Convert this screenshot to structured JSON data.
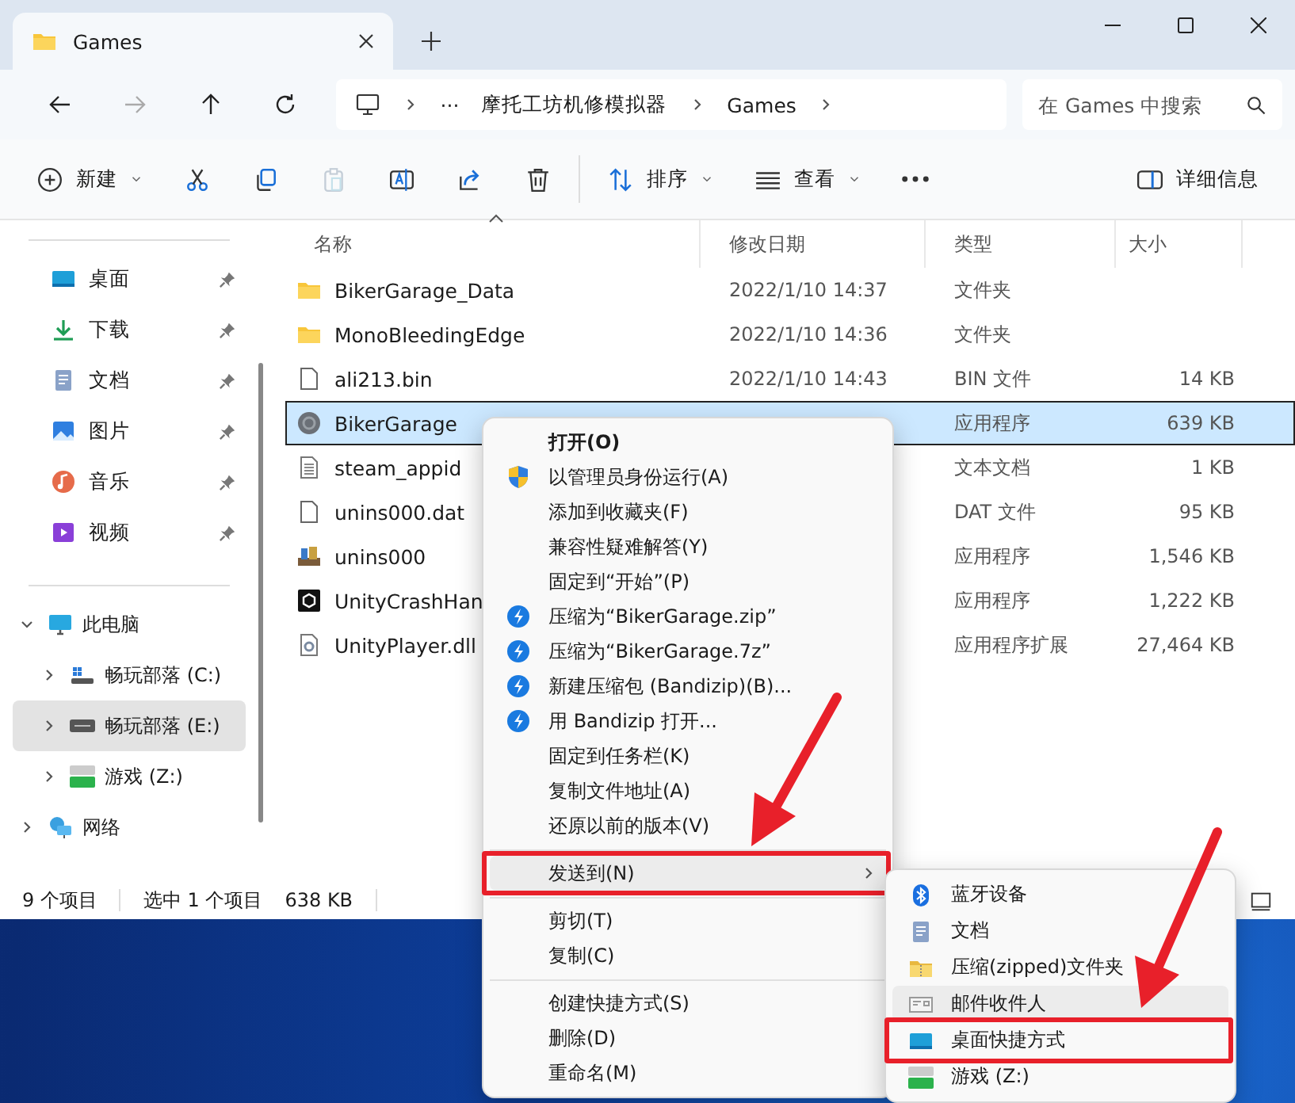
{
  "tab": {
    "title": "Games"
  },
  "address": {
    "crumbs": [
      "···",
      "摩托工坊机修模拟器",
      "Games"
    ]
  },
  "search": {
    "placeholder": "在 Games 中搜索"
  },
  "toolbar": [
    {
      "kind": "new",
      "label": "新建",
      "disabled": false
    },
    {
      "kind": "cut",
      "disabled": false
    },
    {
      "kind": "copy",
      "disabled": false
    },
    {
      "kind": "paste",
      "disabled": true
    },
    {
      "kind": "rename",
      "disabled": false
    },
    {
      "kind": "share",
      "disabled": false
    },
    {
      "kind": "delete",
      "disabled": false
    },
    {
      "kind": "separator"
    },
    {
      "kind": "sort",
      "label": "排序",
      "disabled": false
    },
    {
      "kind": "view",
      "label": "查看",
      "disabled": false
    },
    {
      "kind": "more",
      "disabled": false
    },
    {
      "kind": "spacer"
    },
    {
      "kind": "details",
      "label": "详细信息",
      "disabled": false
    }
  ],
  "sidebar": {
    "quick_access": [
      {
        "label": "桌面",
        "kind": "desktop",
        "pinned": true
      },
      {
        "label": "下载",
        "kind": "download",
        "pinned": true
      },
      {
        "label": "文档",
        "kind": "documents",
        "pinned": true
      },
      {
        "label": "图片",
        "kind": "pictures",
        "pinned": true
      },
      {
        "label": "音乐",
        "kind": "music",
        "pinned": true
      },
      {
        "label": "视频",
        "kind": "videos",
        "pinned": true
      }
    ],
    "tree": [
      {
        "label": "此电脑",
        "kind": "pc",
        "expanded": true,
        "selected": false,
        "children": [
          {
            "label": "畅玩部落 (C:)",
            "kind": "system-drive",
            "expanded": false,
            "selected": false
          },
          {
            "label": "畅玩部落 (E:)",
            "kind": "drive",
            "expanded": false,
            "selected": true
          },
          {
            "label": "游戏 (Z:)",
            "kind": "network-drive",
            "expanded": false,
            "selected": false
          }
        ]
      },
      {
        "label": "网络",
        "kind": "network",
        "expanded": false,
        "selected": false
      }
    ]
  },
  "file_list": {
    "columns": [
      {
        "label": "名称",
        "sorted": true
      },
      {
        "label": "修改日期",
        "sorted": false
      },
      {
        "label": "类型",
        "sorted": false
      },
      {
        "label": "大小",
        "sorted": false
      }
    ],
    "rows": [
      {
        "name": "BikerGarage_Data",
        "kind": "folder",
        "date": "2022/1/10 14:37",
        "type": "文件夹",
        "selected": false
      },
      {
        "name": "MonoBleedingEdge",
        "kind": "folder",
        "date": "2022/1/10 14:36",
        "type": "文件夹",
        "selected": false
      },
      {
        "name": "ali213.bin",
        "kind": "file",
        "date": "2022/1/10 14:43",
        "type": "BIN 文件",
        "size": "14 KB",
        "selected": false
      },
      {
        "name": "BikerGarage",
        "kind": "app",
        "type": "应用程序",
        "size": "639 KB",
        "selected": true
      },
      {
        "name": "steam_appid",
        "kind": "text",
        "type": "文本文档",
        "size": "1 KB",
        "selected": false
      },
      {
        "name": "unins000.dat",
        "kind": "file",
        "type": "DAT 文件",
        "size": "95 KB",
        "selected": false
      },
      {
        "name": "unins000",
        "kind": "installer",
        "type": "应用程序",
        "size": "1,546 KB",
        "selected": false
      },
      {
        "name": "UnityCrashHan",
        "kind": "engine",
        "type": "应用程序",
        "size": "1,222 KB",
        "selected": false
      },
      {
        "name": "UnityPlayer.dll",
        "kind": "dll",
        "type": "应用程序扩展",
        "size": "27,464 KB",
        "selected": false
      }
    ]
  },
  "status_bar": {
    "item_count": "9 个项目",
    "selection": "选中 1 个项目",
    "size": "638 KB"
  },
  "context_menu": [
    {
      "kind": "item",
      "label": "打开(O)",
      "default": true,
      "selected": false
    },
    {
      "kind": "admin",
      "label": "以管理员身份运行(A)",
      "selected": false
    },
    {
      "kind": "item",
      "label": "添加到收藏夹(F)",
      "selected": false
    },
    {
      "kind": "item",
      "label": "兼容性疑难解答(Y)",
      "selected": false
    },
    {
      "kind": "item",
      "label": "固定到“开始”(P)",
      "selected": false
    },
    {
      "kind": "archive",
      "label": "压缩为“BikerGarage.zip”",
      "selected": false
    },
    {
      "kind": "archive",
      "label": "压缩为“BikerGarage.7z”",
      "selected": false
    },
    {
      "kind": "archive",
      "label": "新建压缩包 (Bandizip)(B)...",
      "selected": false
    },
    {
      "kind": "archive",
      "label": "用 Bandizip 打开...",
      "selected": false
    },
    {
      "kind": "item",
      "label": "固定到任务栏(K)",
      "selected": false
    },
    {
      "kind": "item",
      "label": "复制文件地址(A)",
      "selected": false
    },
    {
      "kind": "item",
      "label": "还原以前的版本(V)",
      "selected": false
    },
    {
      "kind": "separator"
    },
    {
      "kind": "submenu",
      "label": "发送到(N)",
      "selected": true,
      "annotated": true
    },
    {
      "kind": "separator"
    },
    {
      "kind": "item",
      "label": "剪切(T)",
      "selected": false
    },
    {
      "kind": "item",
      "label": "复制(C)",
      "selected": false
    },
    {
      "kind": "separator"
    },
    {
      "kind": "item",
      "label": "创建快捷方式(S)",
      "selected": false
    },
    {
      "kind": "item",
      "label": "删除(D)",
      "selected": false
    },
    {
      "kind": "item",
      "label": "重命名(M)",
      "selected": false
    }
  ],
  "send_to_menu": [
    {
      "label": "蓝牙设备",
      "kind": "bluetooth",
      "selected": false,
      "annotated": false
    },
    {
      "label": "文档",
      "kind": "documents",
      "selected": false,
      "annotated": false
    },
    {
      "label": "压缩(zipped)文件夹",
      "kind": "zip-folder",
      "selected": false,
      "annotated": false
    },
    {
      "label": "邮件收件人",
      "kind": "mail",
      "selected": true,
      "annotated": false
    },
    {
      "label": "桌面快捷方式",
      "kind": "desktop",
      "selected": false,
      "annotated": true
    },
    {
      "label": "游戏 (Z:)",
      "kind": "network-drive",
      "selected": false,
      "annotated": false
    }
  ]
}
